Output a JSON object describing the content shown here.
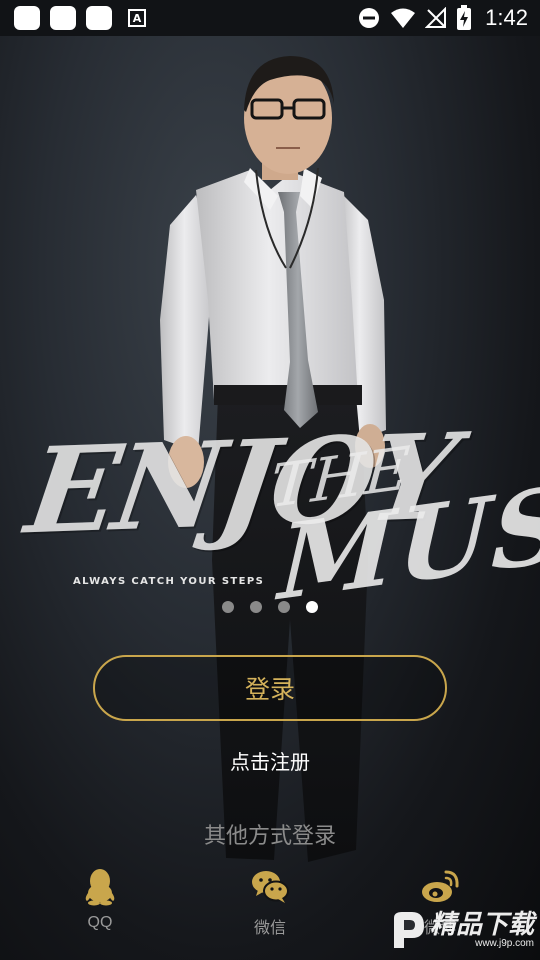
{
  "status_bar": {
    "time": "1:42",
    "notification_letter": "A"
  },
  "hero": {
    "brush_enjoy": "ENJOY",
    "brush_the": "THE",
    "brush_music": "MUSIC",
    "tagline": "ALWAYS CATCH YOUR STEPS"
  },
  "pager": {
    "count": 4,
    "active_index": 3
  },
  "login": {
    "button_label": "登录",
    "register_link": "点击注册",
    "other_methods_label": "其他方式登录"
  },
  "social": [
    {
      "label": "QQ",
      "icon": "qq-penguin-icon"
    },
    {
      "label": "微信",
      "icon": "wechat-icon"
    },
    {
      "label": "微博",
      "icon": "weibo-icon"
    }
  ],
  "watermark": {
    "text": "精品下载",
    "url": "www.j9p.com"
  },
  "colors": {
    "accent_gold": "#d4b25b",
    "icon_gold": "#c9a64c",
    "muted_text": "#8b8b8b"
  }
}
